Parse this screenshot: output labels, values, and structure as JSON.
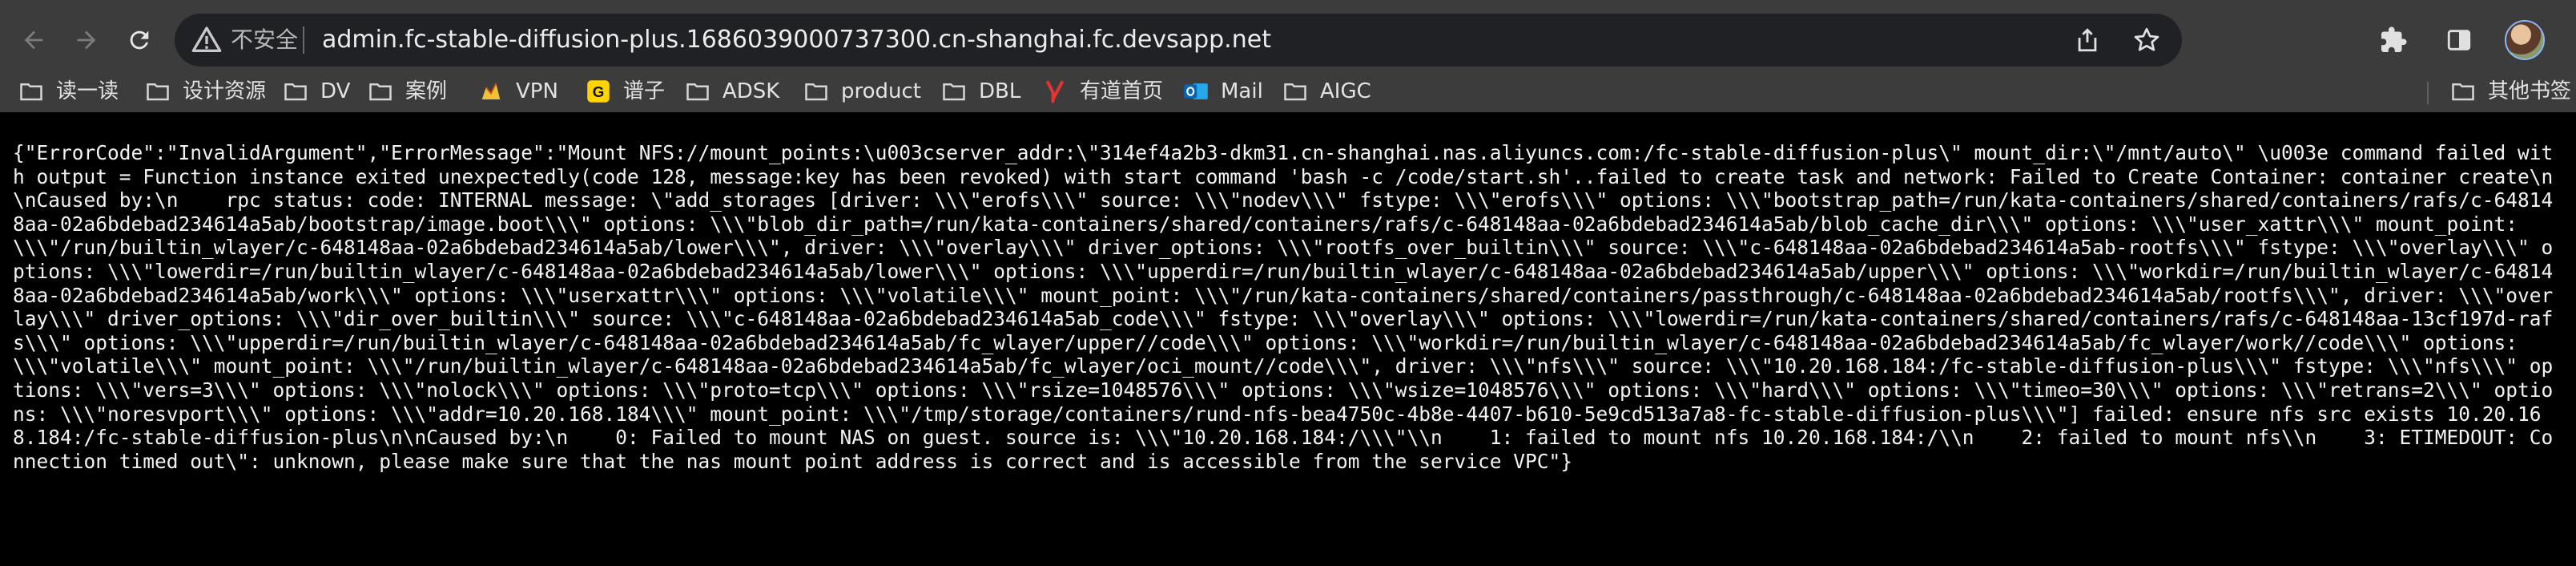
{
  "toolbar": {
    "insecure_label": "不安全",
    "url": "admin.fc-stable-diffusion-plus.1686039000737300.cn-shanghai.fc.devsapp.net"
  },
  "icons": {
    "back": "back-arrow-icon",
    "forward": "forward-arrow-icon",
    "reload": "reload-icon",
    "warning": "warning-triangle-icon",
    "share": "share-icon",
    "bookmark": "star-icon",
    "extensions": "puzzle-icon",
    "sidebar": "side-panel-icon",
    "menu": "kebab-menu-icon",
    "folder": "folder-icon"
  },
  "bookmarks": [
    {
      "label": "读一读",
      "icon": "folder-icon"
    },
    {
      "label": "设计资源",
      "icon": "folder-icon"
    },
    {
      "label": "DV",
      "icon": "folder-icon"
    },
    {
      "label": "案例",
      "icon": "folder-icon"
    },
    {
      "label": "VPN",
      "icon": "vpn-favicon-icon"
    },
    {
      "label": "谱子",
      "icon": "g-favicon-icon"
    },
    {
      "label": "ADSK",
      "icon": "folder-icon"
    },
    {
      "label": "product",
      "icon": "folder-icon"
    },
    {
      "label": "DBL",
      "icon": "folder-icon"
    },
    {
      "label": "有道首页",
      "icon": "youdao-favicon-icon"
    },
    {
      "label": "Mail",
      "icon": "outlook-favicon-icon"
    },
    {
      "label": "AIGC",
      "icon": "folder-icon"
    }
  ],
  "other_bookmarks": "其他书签",
  "colors": {
    "background": "#000000",
    "chrome": "#3c3c3c",
    "omnibox": "#202124",
    "text": "#f2f2f2"
  },
  "page": {
    "error_json": "{\"ErrorCode\":\"InvalidArgument\",\"ErrorMessage\":\"Mount NFS://mount_points:\\u003cserver_addr:\\\"314ef4a2b3-dkm31.cn-shanghai.nas.aliyuncs.com:/fc-stable-diffusion-plus\\\" mount_dir:\\\"/mnt/auto\\\" \\u003e command failed with output = Function instance exited unexpectedly(code 128, message:key has been revoked) with start command 'bash -c /code/start.sh'..failed to create task and network: Failed to Create Container: container create\\n\\nCaused by:\\n    rpc status: code: INTERNAL message: \\\"add_storages [driver: \\\\\\\"erofs\\\\\\\" source: \\\\\\\"nodev\\\\\\\" fstype: \\\\\\\"erofs\\\\\\\" options: \\\\\\\"bootstrap_path=/run/kata-containers/shared/containers/rafs/c-648148aa-02a6bdebad234614a5ab/bootstrap/image.boot\\\\\\\" options: \\\\\\\"blob_dir_path=/run/kata-containers/shared/containers/rafs/c-648148aa-02a6bdebad234614a5ab/blob_cache_dir\\\\\\\" options: \\\\\\\"user_xattr\\\\\\\" mount_point: \\\\\\\"/run/builtin_wlayer/c-648148aa-02a6bdebad234614a5ab/lower\\\\\\\", driver: \\\\\\\"overlay\\\\\\\" driver_options: \\\\\\\"rootfs_over_builtin\\\\\\\" source: \\\\\\\"c-648148aa-02a6bdebad234614a5ab-rootfs\\\\\\\" fstype: \\\\\\\"overlay\\\\\\\" options: \\\\\\\"lowerdir=/run/builtin_wlayer/c-648148aa-02a6bdebad234614a5ab/lower\\\\\\\" options: \\\\\\\"upperdir=/run/builtin_wlayer/c-648148aa-02a6bdebad234614a5ab/upper\\\\\\\" options: \\\\\\\"workdir=/run/builtin_wlayer/c-648148aa-02a6bdebad234614a5ab/work\\\\\\\" options: \\\\\\\"userxattr\\\\\\\" options: \\\\\\\"volatile\\\\\\\" mount_point: \\\\\\\"/run/kata-containers/shared/containers/passthrough/c-648148aa-02a6bdebad234614a5ab/rootfs\\\\\\\", driver: \\\\\\\"overlay\\\\\\\" driver_options: \\\\\\\"dir_over_builtin\\\\\\\" source: \\\\\\\"c-648148aa-02a6bdebad234614a5ab_code\\\\\\\" fstype: \\\\\\\"overlay\\\\\\\" options: \\\\\\\"lowerdir=/run/kata-containers/shared/containers/rafs/c-648148aa-13cf197d-rafs\\\\\\\" options: \\\\\\\"upperdir=/run/builtin_wlayer/c-648148aa-02a6bdebad234614a5ab/fc_wlayer/upper//code\\\\\\\" options: \\\\\\\"workdir=/run/builtin_wlayer/c-648148aa-02a6bdebad234614a5ab/fc_wlayer/work//code\\\\\\\" options: \\\\\\\"volatile\\\\\\\" mount_point: \\\\\\\"/run/builtin_wlayer/c-648148aa-02a6bdebad234614a5ab/fc_wlayer/oci_mount//code\\\\\\\", driver: \\\\\\\"nfs\\\\\\\" source: \\\\\\\"10.20.168.184:/fc-stable-diffusion-plus\\\\\\\" fstype: \\\\\\\"nfs\\\\\\\" options: \\\\\\\"vers=3\\\\\\\" options: \\\\\\\"nolock\\\\\\\" options: \\\\\\\"proto=tcp\\\\\\\" options: \\\\\\\"rsize=1048576\\\\\\\" options: \\\\\\\"wsize=1048576\\\\\\\" options: \\\\\\\"hard\\\\\\\" options: \\\\\\\"timeo=30\\\\\\\" options: \\\\\\\"retrans=2\\\\\\\" options: \\\\\\\"noresvport\\\\\\\" options: \\\\\\\"addr=10.20.168.184\\\\\\\" mount_point: \\\\\\\"/tmp/storage/containers/rund-nfs-bea4750c-4b8e-4407-b610-5e9cd513a7a8-fc-stable-diffusion-plus\\\\\\\"] failed: ensure nfs src exists 10.20.168.184:/fc-stable-diffusion-plus\\n\\nCaused by:\\n    0: Failed to mount NAS on guest. source is: \\\\\\\"10.20.168.184:/\\\\\\\"\\\\n    1: failed to mount nfs 10.20.168.184:/\\\\n    2: failed to mount nfs\\\\n    3: ETIMEDOUT: Connection timed out\\\": unknown, please make sure that the nas mount point address is correct and is accessible from the service VPC\"}"
  }
}
